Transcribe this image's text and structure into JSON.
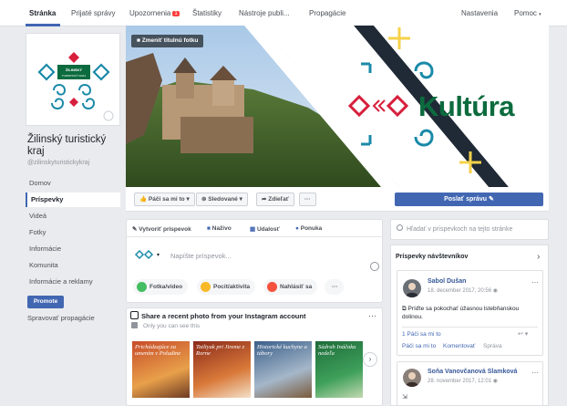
{
  "topnav": {
    "tabs": [
      {
        "label": "Stránka"
      },
      {
        "label": "Prijaté správy"
      },
      {
        "label": "Upozornenia",
        "badge": "1"
      },
      {
        "label": "Štatistiky"
      },
      {
        "label": "Nástroje publi..."
      },
      {
        "label": "Propagácie"
      }
    ],
    "settings": "Nastavenia",
    "help": "Pomoc"
  },
  "sidebar": {
    "page_name": "Žilinský turistický kraj",
    "handle": "@zilinskyturistickykraj",
    "items": [
      "Domov",
      "Príspevky",
      "Videá",
      "Fotky",
      "Informácie",
      "Komunita",
      "Informácie a reklamy"
    ],
    "promote": "Promote",
    "manage_promotions": "Spravovať propagácie"
  },
  "logo_text": "ŽILINSKÝ TURISTICKÝ KRAJ",
  "cover": {
    "change_button": "Zmeniť titulnú fotku",
    "headline": "Kultúra"
  },
  "actions": {
    "like": "Páči sa mi to",
    "following": "Sledované",
    "share": "Zdieľať",
    "more": "···",
    "send_message": "Poslať správu"
  },
  "composer": {
    "tabs": [
      "Vytvoriť príspevok",
      "Naživo",
      "Udalosť",
      "Ponuka"
    ],
    "placeholder": "Napíšte príspevok...",
    "pills": [
      "Fotka/video",
      "Pocit/aktivita",
      "Nahlásiť sa"
    ],
    "more": "···"
  },
  "instagram": {
    "title": "Share a recent photo from your Instagram account",
    "subtitle": "Only you can see this",
    "thumbs": [
      "Prichádzajúce za umením v Poludine",
      "Tatliyak pri Jireme z Rorne",
      "Historické kuchyne a tábory",
      "Súdruh Ináčaku nedeľa"
    ]
  },
  "search": {
    "placeholder": "Hľadať v príspevkoch na tejto stránke"
  },
  "visitor_posts": {
    "title": "Príspevky návštevníkov",
    "posts": [
      {
        "name": "Sabol Dušan",
        "date": "18. december 2017, 20:56",
        "text": "Príďte sa pokochať úžasnou lstebňanskou dolinou.",
        "likes": "1 Páči sa mi to",
        "actions": [
          "Páči sa mi to",
          "Komentovať",
          "Správa"
        ]
      },
      {
        "name": "Soňa Vanovčanová Slamková",
        "date": "28. november 2017, 12:01"
      }
    ]
  },
  "colors": {
    "brand_blue": "#4267b2",
    "cover_green": "#0c6b3e",
    "cover_red": "#d71f3c",
    "cover_yellow": "#f6d24a"
  }
}
